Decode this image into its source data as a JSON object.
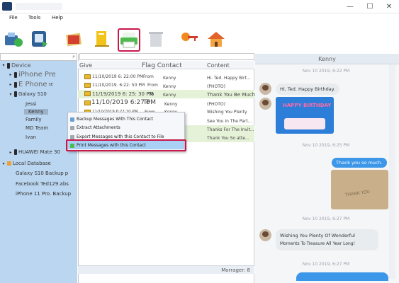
{
  "window": {
    "min_glyph": "—",
    "max_glyph": "☐",
    "close_glyph": "✕"
  },
  "menu": {
    "file": "File",
    "tools": "Tools",
    "help": "Help"
  },
  "tree": {
    "devices": "Device",
    "iphone_pre": "iPhone Pre",
    "ephone": "E Phone",
    "ephone_sup": "SE",
    "galaxy": "Galaxy S10",
    "jessi": "Jessi",
    "kenny": "Kenny",
    "family": "Family",
    "md_team": "MD Team",
    "ivan": "Ivan",
    "huawei": "HUAWEI Mate 30",
    "local_db": "Local Database",
    "backup1": "Galaxy S10 Backup",
    "backup1_suffix": "p",
    "backup2": "Facebook Ted129.abs",
    "backup3": "iPhone 11 Pro. Backup"
  },
  "columns": {
    "give": "Give",
    "flag_contact": "Flag Contact",
    "content": "Content"
  },
  "rows": [
    {
      "date": "11/10/2019 6: 22:00 PM",
      "from": "From",
      "contact": "Kenny",
      "content": "Hi. Ted. Happy Birt..."
    },
    {
      "date": "11/10/2019. 6:22: 50 PM",
      "from": "From",
      "contact": "Kenny",
      "content": "(PHOTO)"
    },
    {
      "date": "11/19/2019 6: 25: 30 PM",
      "from": "To",
      "contact": "Kenny",
      "content": "Thank You Be Much."
    },
    {
      "date": "11/10/2019 6:27 PM",
      "from": "To",
      "contact": "Kenny",
      "content": "(PHOTO)"
    },
    {
      "date": "11/10/2019 6:22:10 PM",
      "from": "From",
      "contact": "Kenny",
      "content": "Wishing You Plenty"
    },
    {
      "date": "",
      "from": "",
      "contact": "",
      "content": "See You In The Part..."
    },
    {
      "date": "",
      "from": "",
      "contact": "",
      "content": "Thanks For The Invit..."
    },
    {
      "date": "",
      "from": "",
      "contact": "",
      "content": "Thank You So atte..."
    }
  ],
  "context_menu": {
    "backup": "Backup Messages With This Contact",
    "extract": "Extract Attachments",
    "export": "Export Messages with this Contact to File",
    "print": "Print Messages with this Contact"
  },
  "status": {
    "messages": "Morrager: 8"
  },
  "chat": {
    "contact_name": "Kenny",
    "ts1": "Nov 10 2019, 6:22 PM",
    "msg1": "Hi, Ted. Happy Birthday.",
    "ts2": "Nov 10 2019, 6:25 PM",
    "msg_out": "Thank you so much.",
    "ts3": "Nov 10 2019, 6:27 PM",
    "ts4": "Nov 10 2019, 6:27 PM",
    "msg2_line1": "Wishing You Plenty Of Wonderful",
    "msg2_line2": "Moments To Treasure All Year Long!",
    "photo1_caption": "HAPPY BIRTHDAY",
    "photo2_caption": "THANK YOU"
  },
  "colors": {
    "accent": "#c9184a",
    "tree_bg": "#bbd6f0",
    "chat_blue": "#3c97e8"
  }
}
